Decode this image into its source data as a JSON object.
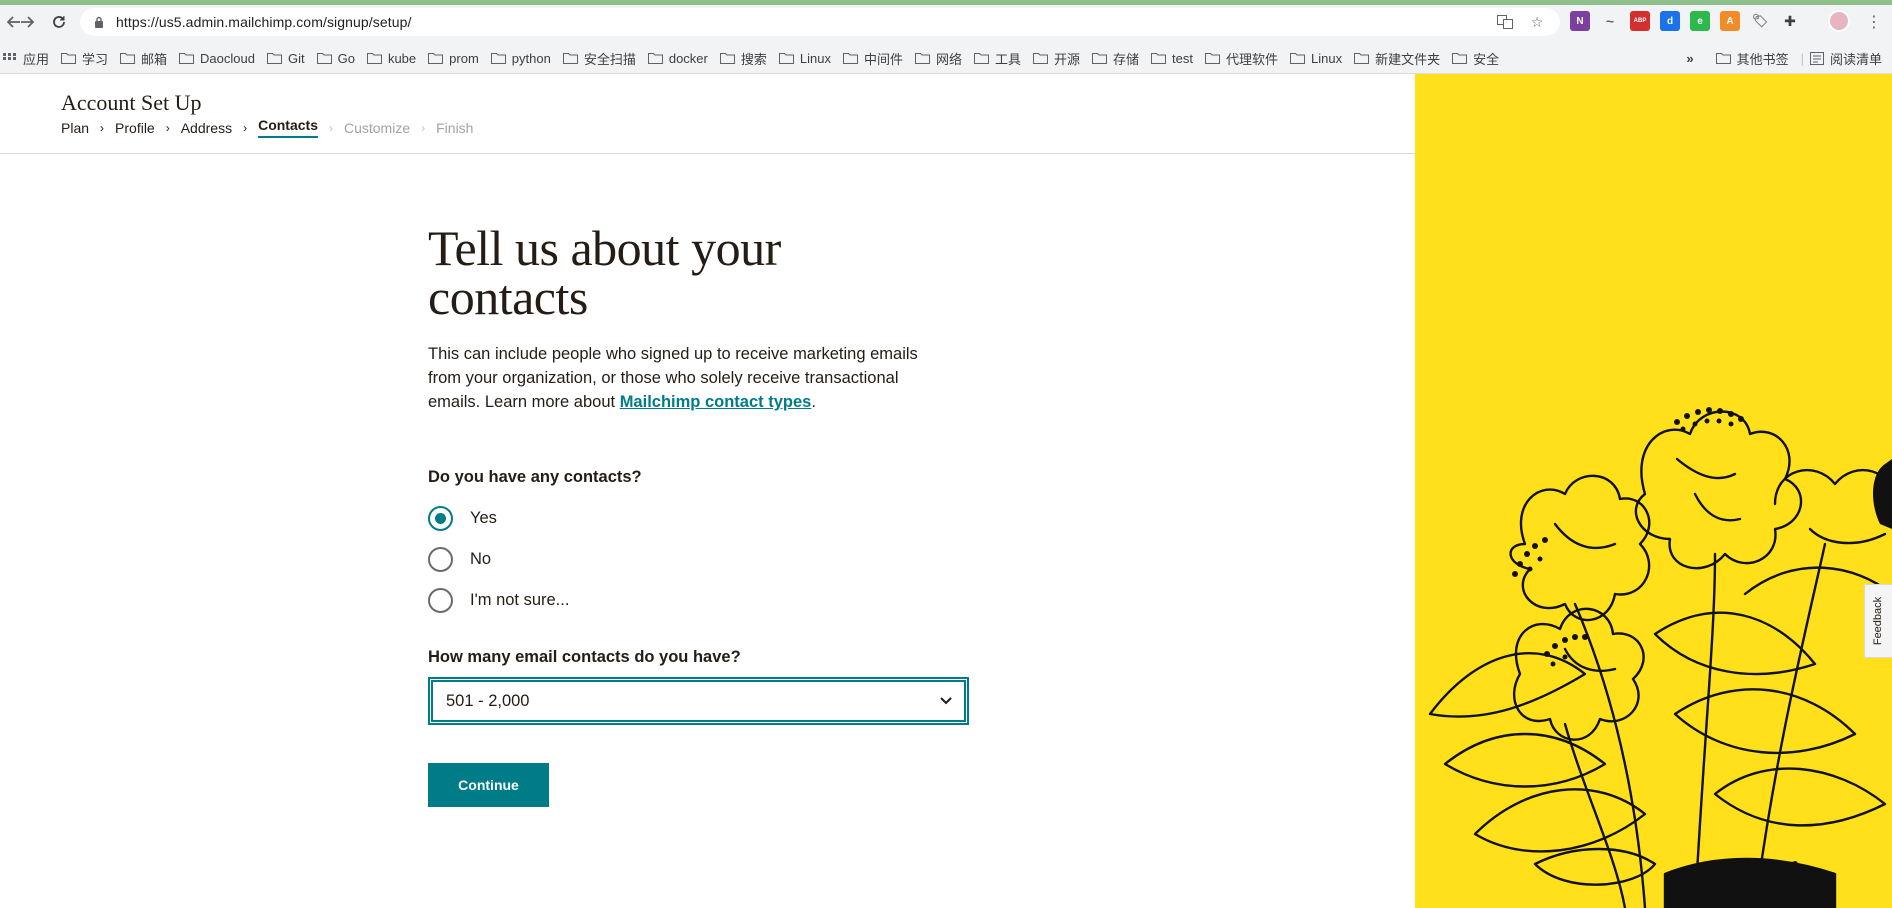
{
  "browser": {
    "url": "https://us5.admin.mailchimp.com/signup/setup/",
    "bookmarks": [
      "应用",
      "学习",
      "邮箱",
      "Daocloud",
      "Git",
      "Go",
      "kube",
      "prom",
      "python",
      "安全扫描",
      "docker",
      "搜索",
      "Linux",
      "中间件",
      "网络",
      "工具",
      "开源",
      "存储",
      "test",
      "代理软件",
      "Linux",
      "新建文件夹",
      "安全"
    ],
    "overflow": "»",
    "other_bookmarks": "其他书签",
    "reading_list": "阅读清单",
    "extensions": [
      {
        "label": "N",
        "color": "#7b3fa0"
      },
      {
        "label": "~",
        "color": "#5f6368"
      },
      {
        "label": "ABP",
        "color": "#d32f2f"
      },
      {
        "label": "d",
        "color": "#1a73e8"
      },
      {
        "label": "e",
        "color": "#2db84d"
      },
      {
        "label": "A",
        "color": "#f28c28"
      },
      {
        "label": "tag",
        "color": "#80868b"
      },
      {
        "label": "puzzle",
        "color": "#3c4043"
      }
    ]
  },
  "header": {
    "title": "Account Set Up",
    "steps": [
      {
        "label": "Plan",
        "state": "done"
      },
      {
        "label": "Profile",
        "state": "done"
      },
      {
        "label": "Address",
        "state": "done"
      },
      {
        "label": "Contacts",
        "state": "active"
      },
      {
        "label": "Customize",
        "state": "disabled"
      },
      {
        "label": "Finish",
        "state": "disabled"
      }
    ]
  },
  "main": {
    "heading_line1": "Tell us about your",
    "heading_line2": "contacts",
    "description_part1": "This can include people who signed up to receive marketing emails from your organization, or those who solely receive transactional emails. Learn more about ",
    "description_link": "Mailchimp contact types",
    "description_end": ".",
    "question1": "Do you have any contacts?",
    "options": [
      {
        "label": "Yes",
        "checked": true
      },
      {
        "label": "No",
        "checked": false
      },
      {
        "label": "I'm not sure...",
        "checked": false
      }
    ],
    "question2": "How many email contacts do you have?",
    "contacts_select_value": "501 - 2,000",
    "continue_label": "Continue"
  },
  "side": {
    "feedback_label": "Feedback",
    "bg_color": "#ffe01b"
  },
  "colors": {
    "accent": "#007c89",
    "text": "#241c15"
  }
}
